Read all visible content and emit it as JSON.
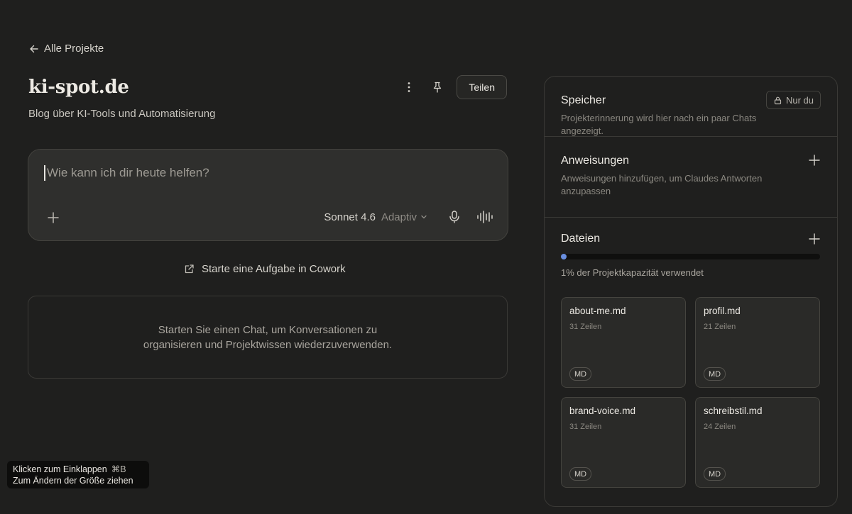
{
  "nav": {
    "back_label": "Alle Projekte"
  },
  "project": {
    "title": "ki-spot.de",
    "description": "Blog über KI-Tools und Automatisierung",
    "share_label": "Teilen"
  },
  "composer": {
    "placeholder": "Wie kann ich dir heute helfen?",
    "model": "Sonnet 4.6",
    "mode": "Adaptiv"
  },
  "cowork": {
    "label": "Starte eine Aufgabe in Cowork"
  },
  "empty_state": {
    "line1": "Starten Sie einen Chat, um Konversationen zu",
    "line2": "organisieren und Projektwissen wiederzuverwenden."
  },
  "tooltip": {
    "line1": "Klicken zum Einklappen",
    "shortcut": "⌘B",
    "line2": "Zum Ändern der Größe ziehen"
  },
  "panel": {
    "memory": {
      "title": "Speicher",
      "badge": "Nur du",
      "subtitle": "Projekterinnerung wird hier nach ein paar Chats angezeigt."
    },
    "instructions": {
      "title": "Anweisungen",
      "subtitle": "Anweisungen hinzufügen, um Claudes Antworten anzupassen"
    },
    "files": {
      "title": "Dateien",
      "capacity_fraction": 0.01,
      "capacity_text": "1% der Projektkapazität verwendet",
      "items": [
        {
          "name": "about-me.md",
          "lines": "31 Zeilen",
          "type": "MD"
        },
        {
          "name": "profil.md",
          "lines": "21 Zeilen",
          "type": "MD"
        },
        {
          "name": "brand-voice.md",
          "lines": "31 Zeilen",
          "type": "MD"
        },
        {
          "name": "schreibstil.md",
          "lines": "24 Zeilen",
          "type": "MD"
        }
      ]
    }
  },
  "colors": {
    "background": "#1f1f1e",
    "capacity_accent": "#6a8fe0"
  }
}
